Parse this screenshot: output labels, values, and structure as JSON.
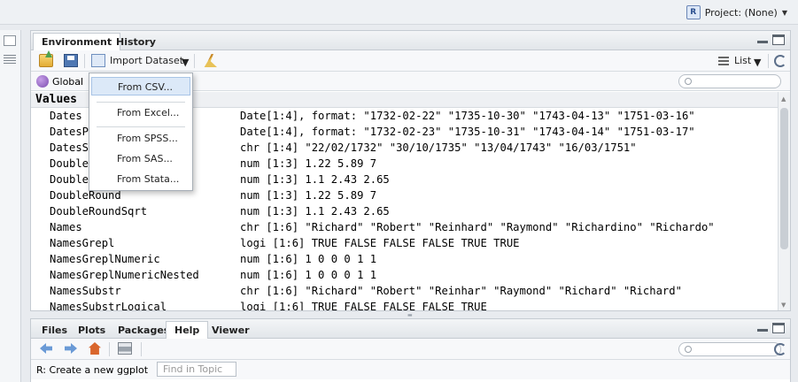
{
  "header": {
    "project_label": "Project: (None)",
    "project_icon": "r-project-icon"
  },
  "env_pane": {
    "tabs": [
      {
        "label": "Environment",
        "active": true
      },
      {
        "label": "History",
        "active": false
      }
    ],
    "toolbar": {
      "import_label": "Import Dataset",
      "view_label": "List"
    },
    "scope": "Global",
    "section_title": "Values",
    "rows": [
      {
        "name": "Dates",
        "value": "Date[1:4], format: \"1732-02-22\" \"1735-10-30\" \"1743-04-13\" \"1751-03-16\""
      },
      {
        "name": "DatesP",
        "value": "Date[1:4], format: \"1732-02-23\" \"1735-10-31\" \"1743-04-14\" \"1751-03-17\""
      },
      {
        "name": "DatesS",
        "value": "chr [1:4] \"22/02/1732\" \"30/10/1735\" \"13/04/1743\" \"16/03/1751\""
      },
      {
        "name": "Double",
        "value": "num [1:3] 1.22 5.89 7"
      },
      {
        "name": "Double",
        "value": "num [1:3] 1.1 2.43 2.65"
      },
      {
        "name": "DoubleRound",
        "value": "num [1:3] 1.22 5.89 7"
      },
      {
        "name": "DoubleRoundSqrt",
        "value": "num [1:3] 1.1 2.43 2.65"
      },
      {
        "name": "Names",
        "value": "chr [1:6] \"Richard\" \"Robert\" \"Reinhard\" \"Raymond\" \"Richardino\" \"Richardo\""
      },
      {
        "name": "NamesGrepl",
        "value": "logi [1:6] TRUE FALSE FALSE FALSE TRUE TRUE"
      },
      {
        "name": "NamesGreplNumeric",
        "value": "num [1:6] 1 0 0 0 1 1"
      },
      {
        "name": "NamesGreplNumericNested",
        "value": "num [1:6] 1 0 0 0 1 1"
      },
      {
        "name": "NamesSubstr",
        "value": "chr [1:6] \"Richard\" \"Robert\" \"Reinhar\" \"Raymond\" \"Richard\" \"Richard\""
      },
      {
        "name": "NamesSubstrLogical",
        "value": "logi [1:6] TRUE FALSE FALSE FALSE TRUE"
      }
    ]
  },
  "import_menu": {
    "items": [
      "From CSV...",
      "From Excel...",
      "From SPSS...",
      "From SAS...",
      "From Stata..."
    ],
    "selected": "From CSV..."
  },
  "help_pane": {
    "tabs": [
      {
        "label": "Files"
      },
      {
        "label": "Plots"
      },
      {
        "label": "Packages"
      },
      {
        "label": "Help",
        "active": true
      },
      {
        "label": "Viewer"
      }
    ],
    "topic": "R: Create a new ggplot",
    "find_placeholder": "Find in Topic"
  }
}
